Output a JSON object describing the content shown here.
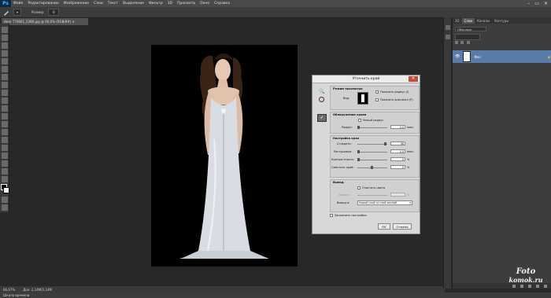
{
  "app": {
    "logo": "Ps",
    "window_controls": [
      "–",
      "▭",
      "✕"
    ]
  },
  "menu": [
    "Файл",
    "Редактирование",
    "Изображение",
    "Слои",
    "Текст",
    "Выделение",
    "Фильтр",
    "3D",
    "Просмотр",
    "Окно",
    "Справка"
  ],
  "options_bar": {
    "size_label": "Размер:",
    "size_value": "8"
  },
  "document": {
    "tab_title": "Hero 770661_5380.jpg @ 66,6% (RGB/8#) ×",
    "zoom": "66,67%",
    "doc_info": "Док: 2,14M/2,14M"
  },
  "bottom_bar": {
    "label": "Шкала времени"
  },
  "panel": {
    "tabs": [
      "3D",
      "Слои",
      "Каналы",
      "Контуры"
    ],
    "kind_filter": "Обычные",
    "layer_name": "Фон"
  },
  "dialog": {
    "title": "Уточнить край",
    "view_mode": {
      "section": "Режим просмотра",
      "view_label": "Вид:",
      "show_radius": "Показать радиус (J)",
      "show_original": "Показать оригинал (P)"
    },
    "edge_detection": {
      "section": "Обнаружение краев",
      "smart_radius": "Умный радиус",
      "radius_label": "Радиус:",
      "radius_value": "0,0",
      "radius_unit": "пикс."
    },
    "adjust_edge": {
      "section": "Настройка края",
      "smooth_label": "Сгладить:",
      "smooth_value": "98",
      "feather_label": "Растушевка:",
      "feather_value": "0,0",
      "feather_unit": "пикс.",
      "contrast_label": "Контрастность:",
      "contrast_value": "0",
      "contrast_unit": "%",
      "shift_label": "Сместить край:",
      "shift_value": "0",
      "shift_unit": "%"
    },
    "output": {
      "section": "Вывод",
      "decontaminate": "Очистить цвета",
      "amount_label": "Эффект:",
      "amount_unit": "%",
      "output_to_label": "Вывод в:",
      "output_to_value": "Новый слой со слой-маской"
    },
    "remember": "Запомнить настройки",
    "ok": "OK",
    "cancel": "Отмена"
  },
  "watermark": {
    "line1": "Foto",
    "line2": "komok.ru"
  },
  "values": {
    "smooth_fraction": 0.98
  }
}
